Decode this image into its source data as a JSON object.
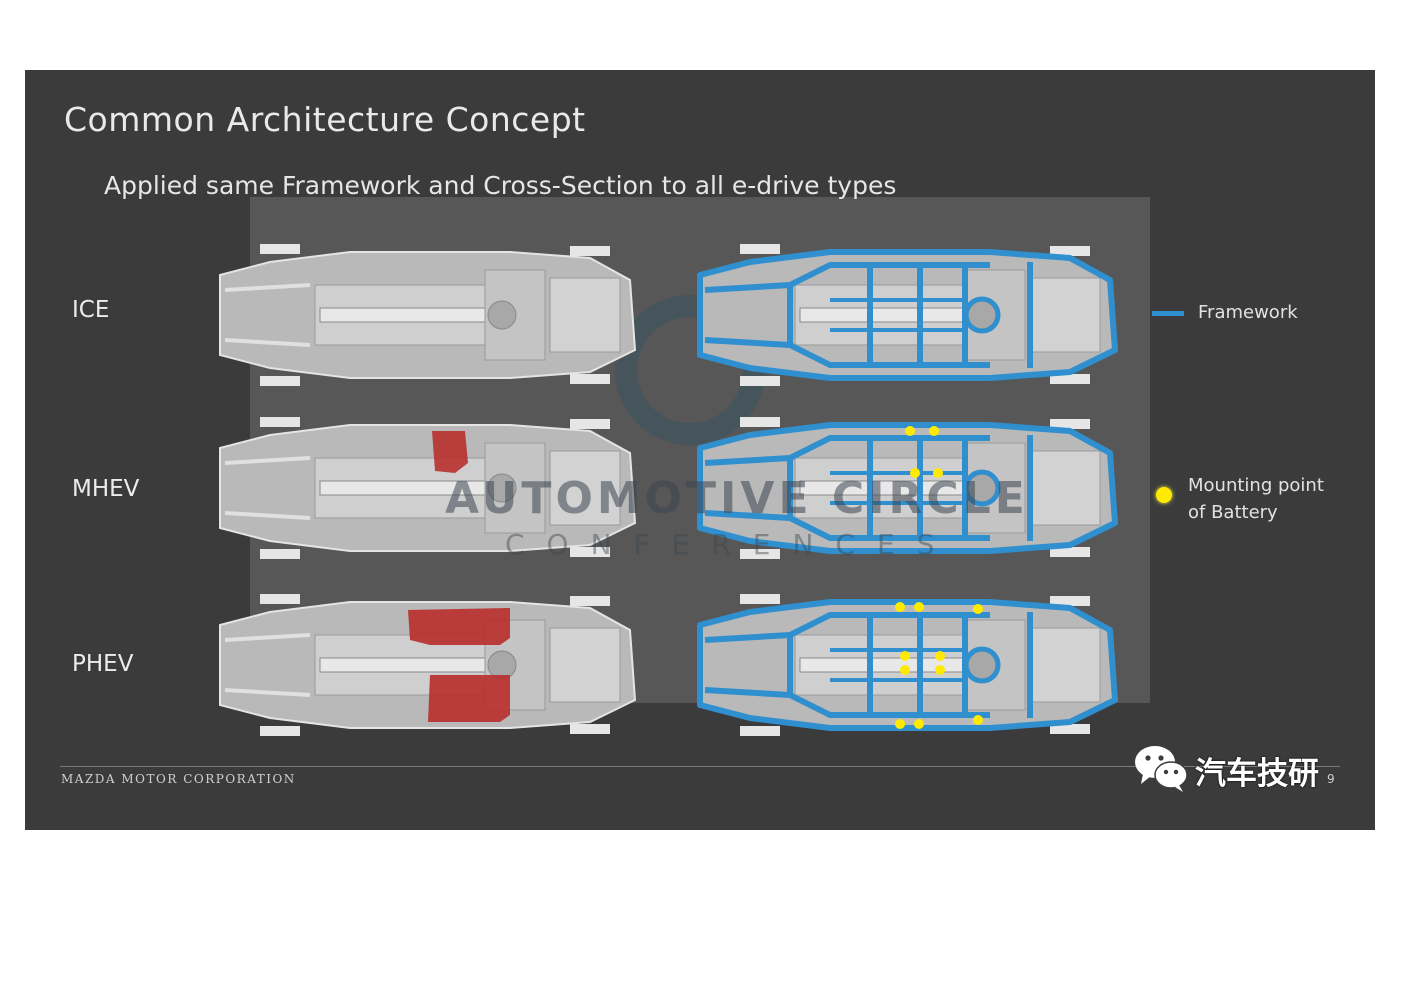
{
  "slide": {
    "title": "Common Architecture Concept",
    "subtitle": "Applied same Framework and Cross-Section to all e-drive types",
    "rows": [
      {
        "label": "ICE"
      },
      {
        "label": "MHEV"
      },
      {
        "label": "PHEV"
      }
    ],
    "legend": {
      "framework_label": "Framework",
      "mounting_label_line1": "Mounting point",
      "mounting_label_line2": "of Battery",
      "framework_color": "#2f8fcf",
      "mounting_color": "#ffea00",
      "battery_color": "#b8312f"
    },
    "footer": "MAZDA MOTOR CORPORATION",
    "page_number": "9",
    "brand": "汽车技研",
    "watermark": {
      "main": "AUTOMOTIVE CIRCLE",
      "sub": "CONFERENCES"
    }
  }
}
